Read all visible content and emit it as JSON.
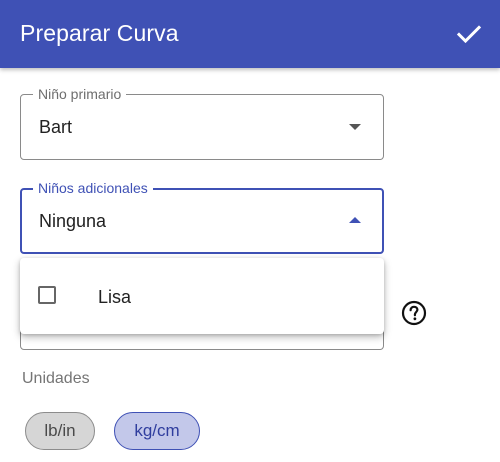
{
  "appbar": {
    "title": "Preparar Curva",
    "confirm_icon": "check-icon"
  },
  "primary_child": {
    "label": "Niño primario",
    "value": "Bart"
  },
  "additional_children": {
    "label": "Niños adicionales",
    "value": "Ninguna",
    "menu_open": true,
    "options": [
      {
        "label": "Lisa",
        "checked": false
      }
    ]
  },
  "help": {
    "icon": "help-circle-icon"
  },
  "units": {
    "label": "Unidades",
    "options": [
      {
        "label": "lb/in",
        "selected": false
      },
      {
        "label": "kg/cm",
        "selected": true
      }
    ]
  },
  "colors": {
    "primary": "#3f51b5",
    "appbar_text": "#ffffff",
    "chip_selected_bg": "#c3c8ea",
    "chip_unselected_bg": "#d6d6d6"
  }
}
